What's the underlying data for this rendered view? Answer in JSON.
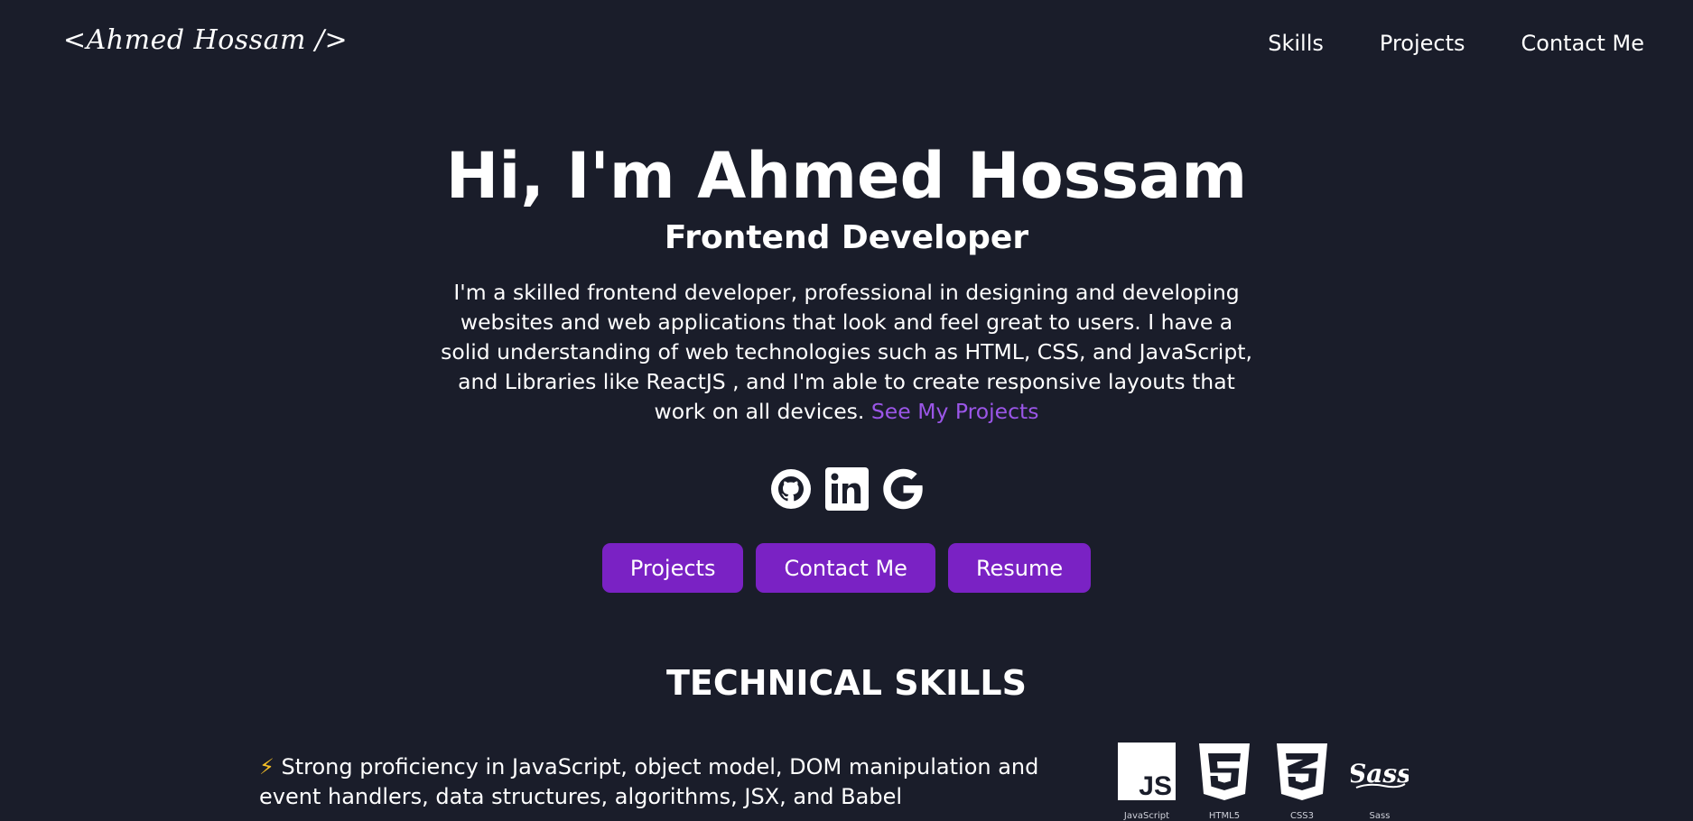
{
  "navbar": {
    "logo": "<Ahmed Hossam />",
    "links": [
      "Skills",
      "Projects",
      "Contact Me"
    ]
  },
  "hero": {
    "title": "Hi, I'm Ahmed Hossam",
    "subtitle": "Frontend Developer",
    "description": "I'm a skilled frontend developer, professional in designing and developing websites and web applications that look and feel great to users. I have a solid understanding of web technologies such as HTML, CSS, and JavaScript, and Libraries like ReactJS , and I'm able to create responsive layouts that work on all devices.",
    "link_text": "See My Projects"
  },
  "socials": [
    {
      "icon": "github-icon"
    },
    {
      "icon": "linkedin-icon"
    },
    {
      "icon": "google-icon"
    }
  ],
  "buttons": [
    "Projects",
    "Contact Me",
    "Resume"
  ],
  "skills": {
    "title": "TECHNICAL SKILLS",
    "items": [
      {
        "bolt": "⚡",
        "text": "Strong proficiency in JavaScript, object model, DOM manipulation and event handlers, data structures, algorithms, JSX, and Babel"
      }
    ],
    "tech_icons": [
      {
        "icon": "javascript-icon",
        "label": "JavaScript"
      },
      {
        "icon": "html5-icon",
        "label": "HTML5"
      },
      {
        "icon": "css3-icon",
        "label": "CSS3"
      },
      {
        "icon": "sass-icon",
        "label": "Sass"
      }
    ]
  },
  "colors": {
    "background": "#1a1d2a",
    "accent": "#7a22c4",
    "link": "#9b56e8",
    "text": "#ffffff"
  }
}
